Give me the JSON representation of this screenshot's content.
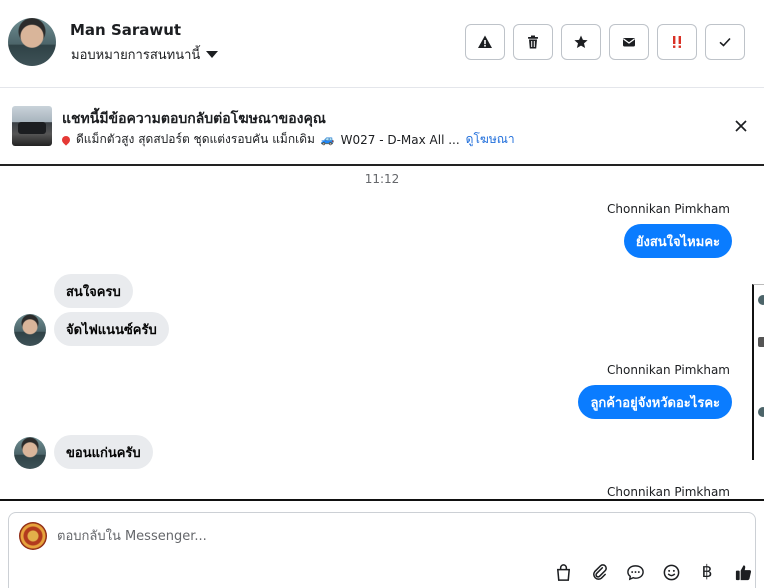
{
  "header": {
    "name": "Man Sarawut",
    "assign_label": "มอบหมายการสนทนานี้",
    "actions": [
      {
        "name": "report-spam-button",
        "icon": "warning-icon"
      },
      {
        "name": "delete-button",
        "icon": "trash-icon"
      },
      {
        "name": "star-button",
        "icon": "star-icon"
      },
      {
        "name": "mark-unread-button",
        "icon": "envelope-icon"
      },
      {
        "name": "follow-up-button",
        "icon": "double-exclamation-icon"
      },
      {
        "name": "mark-done-button",
        "icon": "check-icon"
      }
    ]
  },
  "ad": {
    "title": "แชทนี้มีข้อความตอบกลับต่อโฆษณาของคุณ",
    "description": "ดีแม็กตัวสูง สุดสปอร์ต ชุดแต่งรอบคัน แม็กเดิม",
    "code_text": "W027 - D-Max All ...",
    "link_label": "ดูโฆษณา"
  },
  "conversation": {
    "timestamp": "11:12",
    "messages": [
      {
        "direction": "out",
        "sender": "Chonnikan Pimkham",
        "text": "ยังสนใจไหมคะ"
      },
      {
        "direction": "in",
        "text": "สนใจครบ"
      },
      {
        "direction": "in",
        "text": "จัดไฟแนนซ์ครับ"
      },
      {
        "direction": "out",
        "sender": "Chonnikan Pimkham",
        "text": "ลูกค้าอยู่จังหวัดอะไรคะ"
      },
      {
        "direction": "in",
        "text": "ขอนแก่นครับ"
      },
      {
        "direction": "out",
        "sender": "Chonnikan Pimkham",
        "text": ""
      }
    ]
  },
  "composer": {
    "placeholder": "ตอบกลับใน Messenger...",
    "tools": [
      {
        "name": "shopping-bag-button",
        "icon": "bag-icon"
      },
      {
        "name": "attach-button",
        "icon": "paperclip-icon"
      },
      {
        "name": "saved-reply-button",
        "icon": "chat-bubble-icon"
      },
      {
        "name": "emoji-button",
        "icon": "smiley-icon"
      },
      {
        "name": "payment-button",
        "icon": "baht-icon",
        "glyph": "฿"
      },
      {
        "name": "like-button",
        "icon": "thumbs-up-icon"
      }
    ]
  },
  "colors": {
    "outgoing_bubble": "#0a7cff",
    "incoming_bubble": "#e9ebee",
    "link": "#216fdb",
    "follow_up_icon": "#d93025"
  }
}
